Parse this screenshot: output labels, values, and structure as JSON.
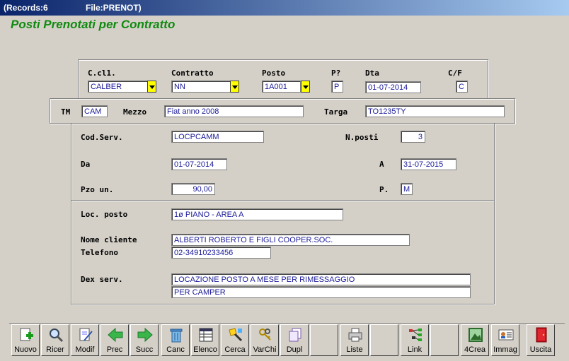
{
  "window": {
    "records_label": "(Records:6",
    "file_label": "File:PRENOT)"
  },
  "heading": "Posti Prenotati per Contratto",
  "header_row": {
    "ccli_label": "C.cl1.",
    "ccli_value": "CALBER",
    "contratto_label": "Contratto",
    "contratto_value": "NN",
    "posto_label": "Posto",
    "posto_value": "1A001",
    "p_label": "P?",
    "p_value": "P",
    "dta_label": "Dta",
    "dta_value": "01-07-2014",
    "cf_label": "C/F",
    "cf_value": "C"
  },
  "vehicle_row": {
    "tm_label": "TM",
    "tm_value": "CAM",
    "mezzo_label": "Mezzo",
    "mezzo_value": "Fiat anno 2008",
    "targa_label": "Targa",
    "targa_value": "TO1235TY"
  },
  "service": {
    "codserv_label": "Cod.Serv.",
    "codserv_value": "LOCPCAMM",
    "nposti_label": "N.posti",
    "nposti_value": "3",
    "da_label": "Da",
    "da_value": "01-07-2014",
    "a_label": "A",
    "a_value": "31-07-2015",
    "pzo_label": "Pzo un.",
    "pzo_value": "90,00",
    "p_label": "P.",
    "p_value": "M"
  },
  "details": {
    "locposto_label": "Loc. posto",
    "locposto_value": "1ø PIANO - AREA A",
    "nome_label": "Nome cliente",
    "nome_value": "ALBERTI ROBERTO E FIGLI COOPER.SOC.",
    "tel_label": "Telefono",
    "tel_value": "02-34910233456",
    "dex_label": "Dex serv.",
    "dex_value1": "LOCAZIONE POSTO A MESE PER RIMESSAGGIO",
    "dex_value2": "PER CAMPER"
  },
  "toolbar": {
    "nuovo": "Nuovo",
    "ricer": "Ricer",
    "modif": "Modif",
    "prec": "Prec",
    "succ": "Succ",
    "canc": "Canc",
    "elenco": "Elenco",
    "cerca": "Cerca",
    "varchi": "VarChi",
    "dupl": "Dupl",
    "liste": "Liste",
    "link": "Link",
    "crea4": "4Crea",
    "immag": "Immag",
    "uscita": "Uscita"
  },
  "colors": {
    "title_bar": "#0a246a",
    "heading": "#108a10",
    "field_text": "#1a1a99",
    "dropdown_button": "#ffff00"
  }
}
